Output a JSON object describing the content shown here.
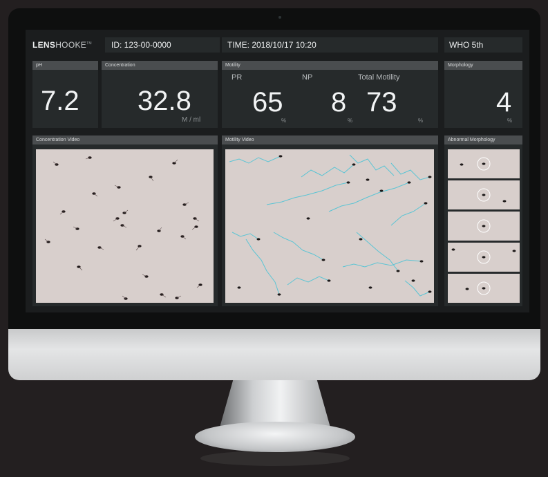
{
  "header": {
    "logo_bold": "LENS",
    "logo_light": "HOOKE",
    "logo_mark": "TM",
    "id": "ID: 123-00-0000",
    "time": "TIME: 2018/10/17  10:20",
    "standard": "WHO 5th"
  },
  "ph": {
    "title": "pH",
    "value": "7.2"
  },
  "concentration": {
    "title": "Concentration",
    "value": "32.8",
    "unit": "M / ml"
  },
  "motility": {
    "title": "Motility",
    "pr_label": "PR",
    "pr_value": "65",
    "pr_unit": "%",
    "np_label": "NP",
    "np_value": "8",
    "np_unit": "%",
    "total_label": "Total Motility",
    "total_value": "73",
    "total_unit": "%"
  },
  "morphology": {
    "title": "Morphology",
    "value": "4",
    "unit": "%"
  },
  "videos": {
    "concentration_title": "Concentration Video",
    "motility_title": "Motility Video",
    "abnormal_title": "Abnormal Morphology"
  },
  "colors": {
    "screen_bg": "#1b1d1e",
    "tile_bg": "#262a2b",
    "header_bar": "#4a4d4f",
    "video_bg": "#d8cfcc",
    "track": "#45c3d6"
  }
}
